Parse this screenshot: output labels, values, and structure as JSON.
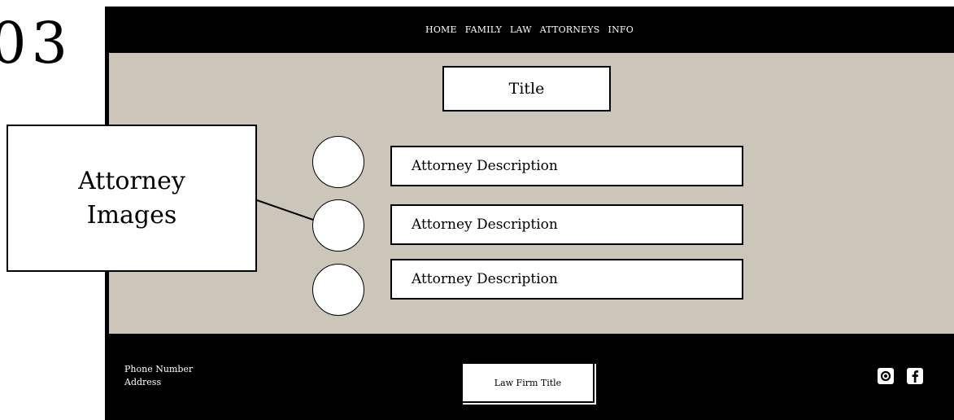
{
  "page_number": "03",
  "nav": {
    "items": [
      "HOME",
      "FAMILY",
      "LAW",
      "ATTORNEYS",
      "INFO"
    ]
  },
  "main": {
    "title": "Title",
    "attorneys": [
      {
        "description": "Attorney Description"
      },
      {
        "description": "Attorney Description"
      },
      {
        "description": "Attorney Description"
      }
    ]
  },
  "footer": {
    "phone": "Phone Number",
    "address": "Address",
    "firm_title": "Law Firm Title",
    "social_icons": [
      "instagram-icon",
      "facebook-icon"
    ]
  },
  "callout": {
    "line1": "Attorney",
    "line2": "Images"
  },
  "colors": {
    "frame": "#000000",
    "content_bg": "#cbc5ba",
    "box_bg": "#ffffff"
  }
}
